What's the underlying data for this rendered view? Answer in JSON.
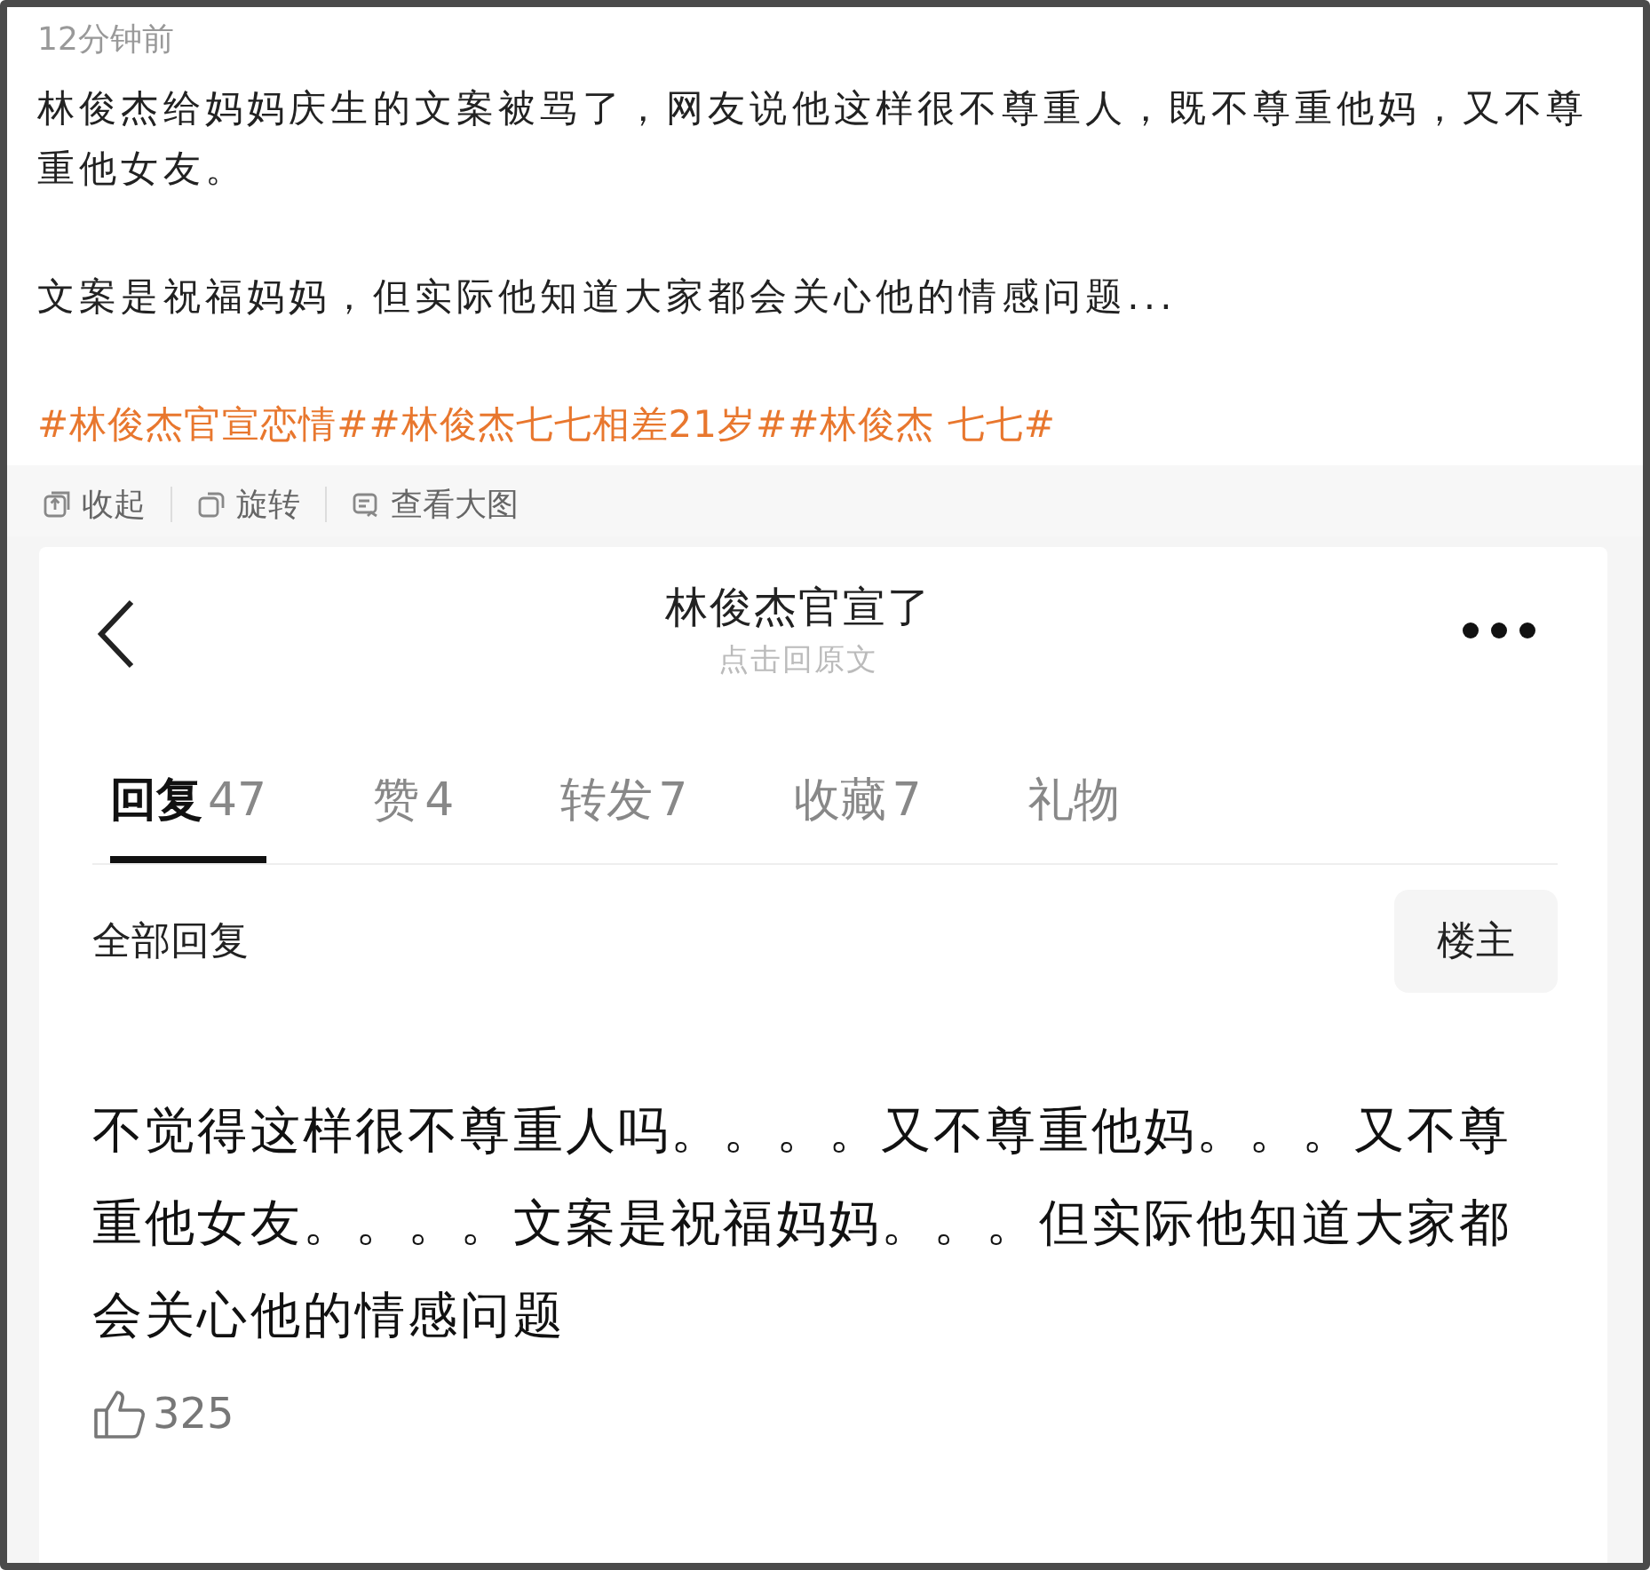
{
  "post": {
    "time": "12分钟前",
    "paragraphs": [
      "林俊杰给妈妈庆生的文案被骂了，网友说他这样很不尊重人，既不尊重他妈，又不尊重他女友。",
      "文案是祝福妈妈，但实际他知道大家都会关心他的情感问题..."
    ],
    "hashtags": "#林俊杰官宣恋情##林俊杰七七相差21岁##林俊杰 七七#"
  },
  "toolbar": [
    {
      "kind": "collapse",
      "label": "收起"
    },
    {
      "kind": "rotate",
      "label": "旋转"
    },
    {
      "kind": "zoom",
      "label": "查看大图"
    }
  ],
  "screenshot": {
    "title": "林俊杰官宣了",
    "subtitle": "点击回原文",
    "tabs": [
      {
        "label": "回复",
        "count": "47",
        "selected": true
      },
      {
        "label": "赞",
        "count": "4",
        "selected": false
      },
      {
        "label": "转发",
        "count": "7",
        "selected": false
      },
      {
        "label": "收藏",
        "count": "7",
        "selected": false
      },
      {
        "label": "礼物",
        "selected": false
      }
    ],
    "section_title": "全部回复",
    "filter_button": "楼主",
    "comment": {
      "text": "不觉得这样很不尊重人吗。。。。又不尊重他妈。。。又不尊重他女友。。。。文案是祝福妈妈。。。但实际他知道大家都会关心他的情感问题",
      "likes": "325"
    }
  }
}
